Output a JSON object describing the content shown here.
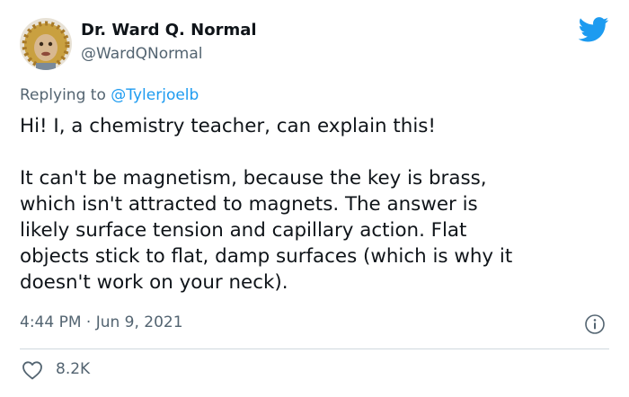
{
  "author": {
    "display_name": "Dr. Ward Q. Normal",
    "handle": "@WardQNormal"
  },
  "reply": {
    "prefix": "Replying to",
    "mention": "@Tylerjoelb"
  },
  "tweet": {
    "lines_para1": [
      "Hi! I, a chemistry teacher, can explain this!"
    ],
    "lines_para2": [
      "It can't be magnetism, because the key is brass,",
      "which isn't attracted to magnets. The answer is",
      "likely surface tension and capillary action. Flat",
      "objects stick to flat, damp surfaces (which is why it",
      "doesn't work on your neck)."
    ]
  },
  "meta": {
    "timestamp": "4:44 PM · Jun 9, 2021"
  },
  "engagement": {
    "likes": "8.2K"
  },
  "icons": {
    "brand": "twitter-bird-icon",
    "info": "info-icon",
    "like": "heart-icon"
  },
  "colors": {
    "brand_blue": "#1d9bf0",
    "text_primary": "#0f1419",
    "text_secondary": "#536471",
    "divider": "#cfd9de"
  }
}
